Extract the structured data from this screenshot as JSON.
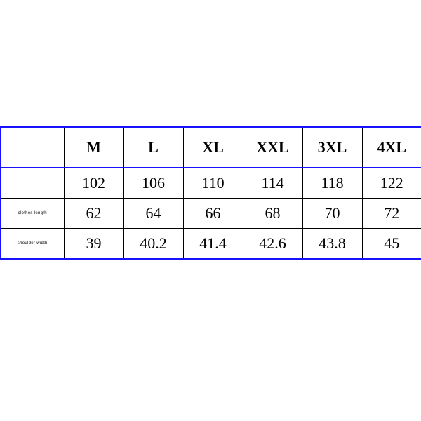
{
  "chart_data": {
    "type": "table",
    "title": "",
    "columns": [
      "",
      "M",
      "L",
      "XL",
      "XXL",
      "3XL",
      "4XL"
    ],
    "rows": [
      {
        "label": "",
        "values": [
          102,
          106,
          110,
          114,
          118,
          122
        ]
      },
      {
        "label": "clothes length",
        "values": [
          62,
          64,
          66,
          68,
          70,
          72
        ]
      },
      {
        "label": "shoulder width",
        "values": [
          39,
          40.2,
          41.4,
          42.6,
          43.8,
          45
        ]
      }
    ]
  }
}
